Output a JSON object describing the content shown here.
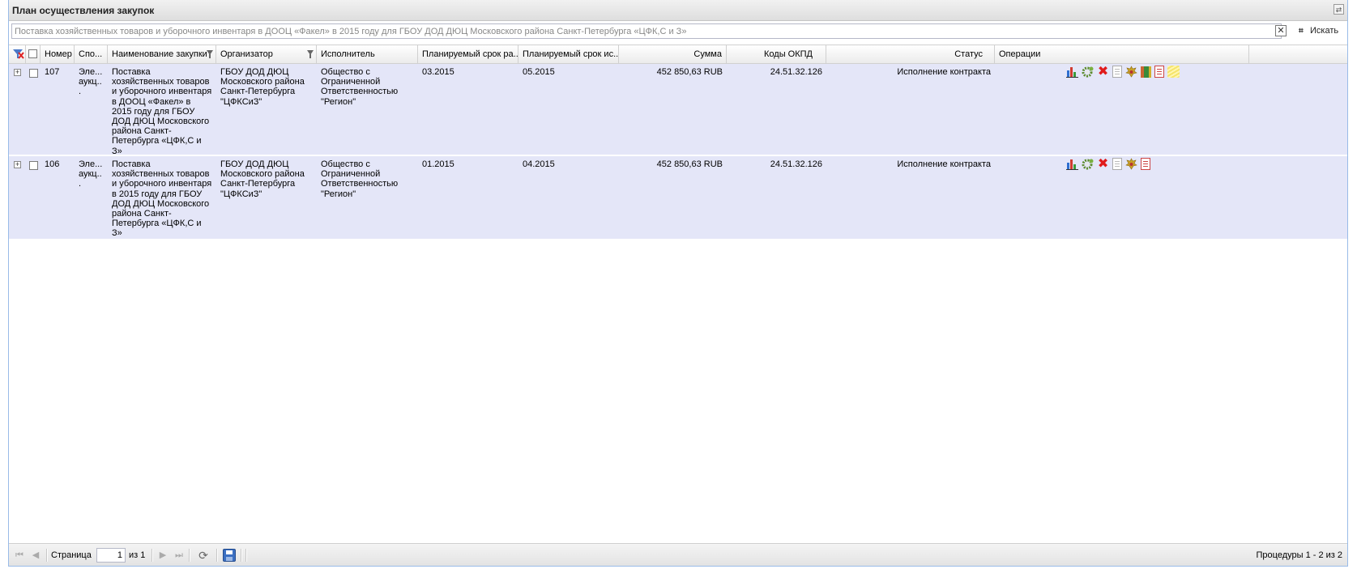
{
  "panel": {
    "title": "План осуществления закупок"
  },
  "search": {
    "value": "Поставка хозяйственных товаров и уборочного инвентаря в ДООЦ «Факел» в 2015 году для ГБОУ ДОД ДЮЦ Московского района Санкт-Петербурга «ЦФК,С и З»",
    "button_label": "Искать"
  },
  "columns": {
    "number": "Номер",
    "method": "Спо...",
    "name": "Наименование закупки",
    "organizer": "Организатор",
    "executor": "Исполнитель",
    "plan_start": "Планируемый срок ра...",
    "plan_exec": "Планируемый срок ис...",
    "sum": "Сумма",
    "okpd": "Коды ОКПД",
    "status": "Статус",
    "operations": "Операции"
  },
  "rows": [
    {
      "number": "107",
      "method": "Эле... аукц...",
      "name": "Поставка хозяйственных товаров и уборочного инвентаря в ДООЦ «Факел» в 2015 году для ГБОУ ДОД ДЮЦ Московского района Санкт-Петербурга «ЦФК,С и З»",
      "organizer": "ГБОУ ДОД ДЮЦ Московского района Санкт-Петербурга \"ЦФКСиЗ\"",
      "executor": "Общество с Ограниченной Ответственностью \"Регион\"",
      "plan_start": "03.2015",
      "plan_exec": "05.2015",
      "sum": "452 850,63 RUB",
      "okpd": "24.51.32.126",
      "status": "Исполнение контракта",
      "operations": [
        "chart-icon",
        "gear-icon",
        "delete-icon",
        "document-icon",
        "emblem-icon",
        "book-icon",
        "red-document-icon",
        "notes-icon"
      ]
    },
    {
      "number": "106",
      "method": "Эле... аукц...",
      "name": "Поставка хозяйственных товаров и уборочного инвентаря в 2015 году для ГБОУ ДОД ДЮЦ Московского района Санкт-Петербурга «ЦФК,С и З»",
      "organizer": "ГБОУ ДОД ДЮЦ Московского района Санкт-Петербурга \"ЦФКСиЗ\"",
      "executor": "Общество с Ограниченной Ответственностью \"Регион\"",
      "plan_start": "01.2015",
      "plan_exec": "04.2015",
      "sum": "452 850,63 RUB",
      "okpd": "24.51.32.126",
      "status": "Исполнение контракта",
      "operations": [
        "chart-icon",
        "gear-icon",
        "delete-icon",
        "document-icon",
        "emblem-icon",
        "red-document-icon"
      ]
    }
  ],
  "paging": {
    "page_label": "Страница",
    "page_value": "1",
    "of_label": "из 1",
    "summary": "Процедуры 1 - 2 из 2"
  },
  "colors": {
    "row_bg": "#e4e6f8",
    "header_bg": "#ebebeb",
    "delete_red": "#e01b1b"
  }
}
